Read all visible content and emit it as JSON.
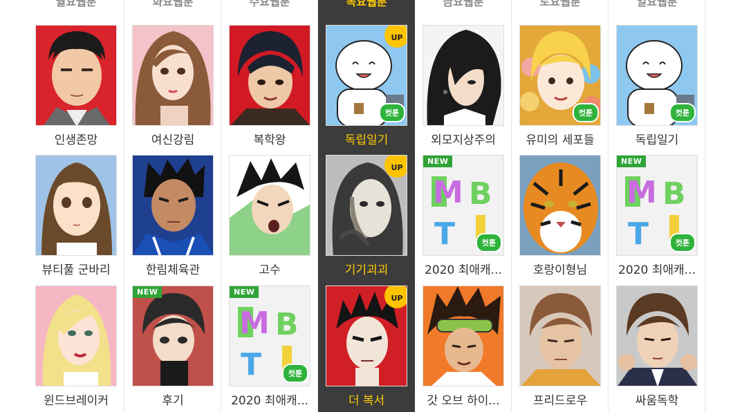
{
  "days": [
    "월요웹툰",
    "화요웹툰",
    "수요웹툰",
    "목요웹툰",
    "금요웹툰",
    "토요웹툰",
    "일요웹툰"
  ],
  "badges": {
    "up": "UP",
    "new": "NEW",
    "cut": "컷툰"
  },
  "colors": {
    "active_bg": "#3c3c3c",
    "active_text": "#ffcc00",
    "badge_up": "#ffc400",
    "badge_new": "#2fa437"
  },
  "columns": [
    {
      "items": [
        {
          "title": "인생존망"
        },
        {
          "title": "뷰티풀 군바리"
        },
        {
          "title": "윈드브레이커"
        }
      ]
    },
    {
      "items": [
        {
          "title": "여신강림"
        },
        {
          "title": "한림체육관"
        },
        {
          "title": "후기"
        }
      ]
    },
    {
      "items": [
        {
          "title": "복학왕"
        },
        {
          "title": "고수"
        },
        {
          "title": "2020 최애캐..."
        }
      ]
    },
    {
      "items": [
        {
          "title": "독립일기"
        },
        {
          "title": "기기괴괴"
        },
        {
          "title": "더 복서"
        }
      ]
    },
    {
      "items": [
        {
          "title": "외모지상주의"
        },
        {
          "title": "2020 최애캐..."
        },
        {
          "title": "갓 오브 하이..."
        }
      ]
    },
    {
      "items": [
        {
          "title": "유미의 세포들"
        },
        {
          "title": "호랑이형님"
        },
        {
          "title": "프리드로우"
        }
      ]
    },
    {
      "items": [
        {
          "title": "독립일기"
        },
        {
          "title": "2020 최애캐..."
        },
        {
          "title": "싸움독학"
        }
      ]
    }
  ]
}
